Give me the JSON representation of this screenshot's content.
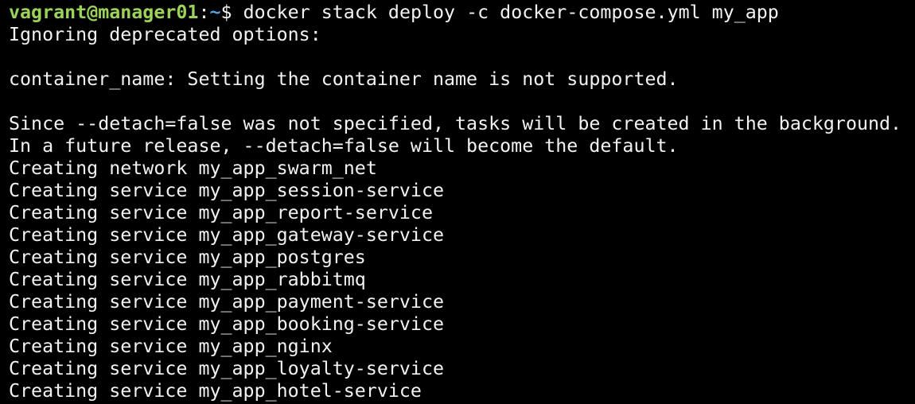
{
  "colors": {
    "background": "#000000",
    "text": "#f2f2f2",
    "prompt_user": "#9bd35a",
    "prompt_path": "#4fa3e6"
  },
  "prompt": {
    "user_host": "vagrant@manager01",
    "separator": ":",
    "path": "~",
    "symbol": "$ ",
    "command": "docker stack deploy -c docker-compose.yml my_app"
  },
  "output": [
    "Ignoring deprecated options:",
    "",
    "container_name: Setting the container name is not supported.",
    "",
    "Since --detach=false was not specified, tasks will be created in the background.",
    "In a future release, --detach=false will become the default.",
    "Creating network my_app_swarm_net",
    "Creating service my_app_session-service",
    "Creating service my_app_report-service",
    "Creating service my_app_gateway-service",
    "Creating service my_app_postgres",
    "Creating service my_app_rabbitmq",
    "Creating service my_app_payment-service",
    "Creating service my_app_booking-service",
    "Creating service my_app_nginx",
    "Creating service my_app_loyalty-service",
    "Creating service my_app_hotel-service"
  ]
}
